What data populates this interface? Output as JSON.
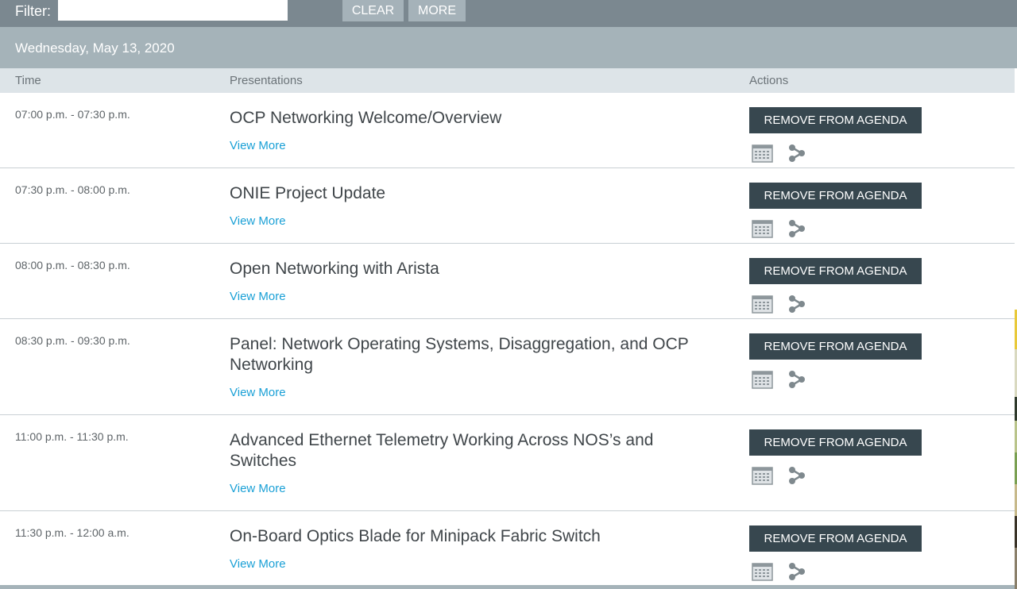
{
  "filter": {
    "label": "Filter:",
    "value": "",
    "placeholder": "",
    "clear_label": "CLEAR",
    "more_label": "MORE"
  },
  "date_header": "Wednesday, May 13, 2020",
  "columns": {
    "time": "Time",
    "presentations": "Presentations",
    "actions": "Actions"
  },
  "sessions": [
    {
      "time": "07:00 p.m. - 07:30 p.m.",
      "title": "OCP Networking Welcome/Overview",
      "view_more": "View More",
      "action": "REMOVE FROM AGENDA"
    },
    {
      "time": "07:30 p.m. - 08:00 p.m.",
      "title": "ONIE Project Update",
      "view_more": "View More",
      "action": "REMOVE FROM AGENDA"
    },
    {
      "time": "08:00 p.m. - 08:30 p.m.",
      "title": "Open Networking with Arista",
      "view_more": "View More",
      "action": "REMOVE FROM AGENDA"
    },
    {
      "time": "08:30 p.m. - 09:30 p.m.",
      "title": "Panel: Network Operating Systems, Disaggregation, and OCP Networking",
      "view_more": "View More",
      "action": "REMOVE FROM AGENDA"
    },
    {
      "time": "11:00 p.m. - 11:30 p.m.",
      "title": "Advanced Ethernet Telemetry Working Across NOS’s and Switches",
      "view_more": "View More",
      "action": "REMOVE FROM AGENDA"
    },
    {
      "time": "11:30 p.m. - 12:00 a.m.",
      "title": "On-Board Optics Blade for Minipack Fabric Switch",
      "view_more": "View More",
      "action": "REMOVE FROM AGENDA"
    }
  ],
  "icons": {
    "calendar": "calendar-icon",
    "share": "share-icon"
  },
  "colors": {
    "topbar": "#7b8890",
    "date_bar": "#a5b3b9",
    "action_button": "#37474f",
    "link": "#1aa0d6"
  }
}
